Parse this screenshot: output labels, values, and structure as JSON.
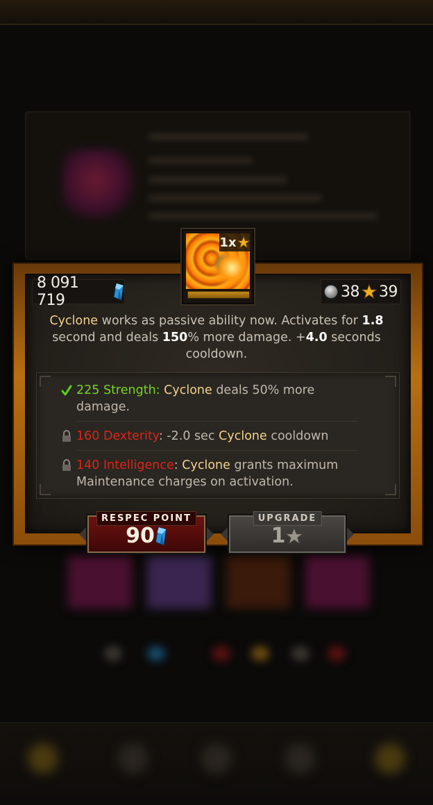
{
  "currency": {
    "gems_amount": "8 091 719",
    "silver_amount": "38",
    "stars_amount": "39"
  },
  "skill": {
    "icon": "cyclone-skill-icon",
    "badge_count": "1x"
  },
  "description": {
    "skill_name": "Cyclone",
    "part1": " works as passive ability now. Activates for ",
    "duration": "1.8",
    "part2": " second and deals ",
    "damage": "150",
    "part3": "% more damage.  +",
    "cooldown": "4.0",
    "part4": " seconds cooldown."
  },
  "requirements": [
    {
      "status": "met",
      "icon": "checkmark-icon",
      "stat": "225 Strength",
      "sep": ": ",
      "skill": "Cyclone",
      "text": " deals 50% more damage."
    },
    {
      "status": "locked",
      "icon": "lock-icon",
      "stat": "160 Dexterity",
      "sep": ": -2.0 sec ",
      "skill": "Cyclone",
      "text": " cooldown"
    },
    {
      "status": "locked",
      "icon": "lock-icon",
      "stat": "140 Intelligence",
      "sep": ": ",
      "skill": "Cyclone",
      "text": " grants maximum Maintenance charges on activation."
    }
  ],
  "buttons": {
    "respec": {
      "label": "RESPEC POINT",
      "value": "90"
    },
    "upgrade": {
      "label": "UPGRADE",
      "value": "1"
    }
  },
  "colors": {
    "accent_orange": "#b86f12",
    "met_green": "#74d624",
    "locked_red": "#d8261a",
    "highlight_yellow": "#f3d28c"
  }
}
